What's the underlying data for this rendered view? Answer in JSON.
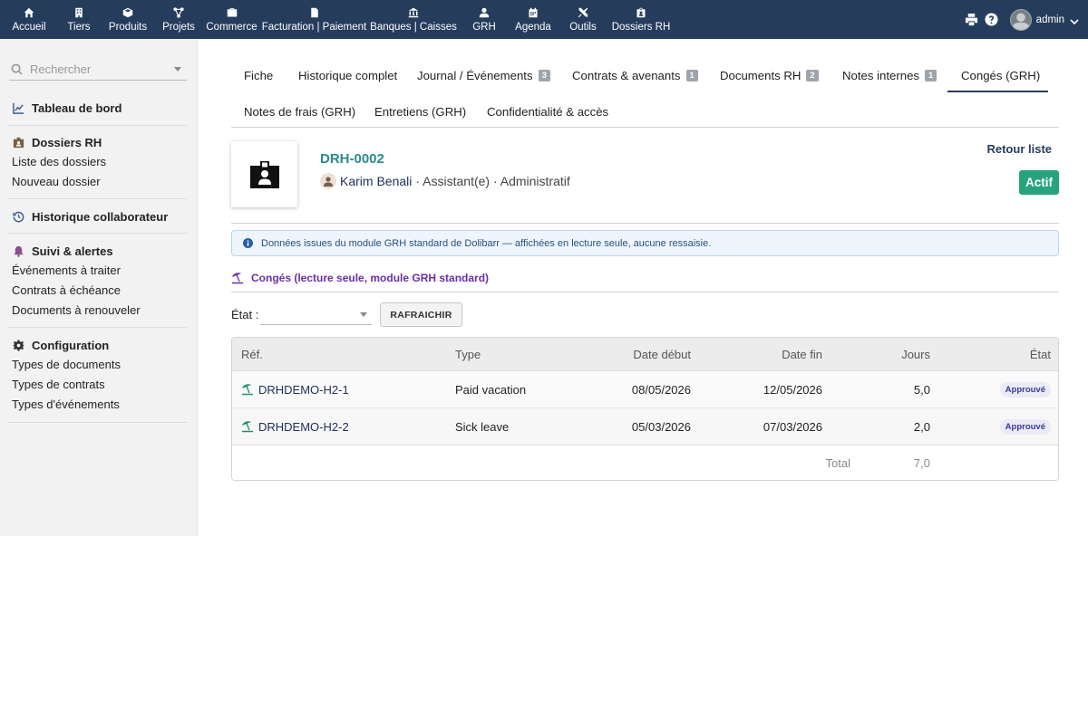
{
  "topnav": {
    "items": [
      {
        "label": "Accueil",
        "icon": "home-icon"
      },
      {
        "label": "Tiers",
        "icon": "building-icon"
      },
      {
        "label": "Produits",
        "icon": "cube-icon"
      },
      {
        "label": "Projets",
        "icon": "project-icon"
      },
      {
        "label": "Commerce",
        "icon": "briefcase-icon"
      },
      {
        "label": "Facturation | Paiement",
        "icon": "invoice-icon"
      },
      {
        "label": "Banques | Caisses",
        "icon": "bank-icon"
      },
      {
        "label": "GRH",
        "icon": "user-tie-icon"
      },
      {
        "label": "Agenda",
        "icon": "calendar-icon"
      },
      {
        "label": "Outils",
        "icon": "tools-icon"
      },
      {
        "label": "Dossiers RH",
        "icon": "id-badge-icon"
      }
    ],
    "user": "admin"
  },
  "sidebar": {
    "search_placeholder": "Rechercher",
    "dashboard": "Tableau de bord",
    "dossiers": {
      "title": "Dossiers RH",
      "items": [
        "Liste des dossiers",
        "Nouveau dossier"
      ]
    },
    "historique": "Historique collaborateur",
    "suivi": {
      "title": "Suivi & alertes",
      "items": [
        "Événements à traiter",
        "Contrats à échéance",
        "Documents à renouveler"
      ]
    },
    "config": {
      "title": "Configuration",
      "items": [
        "Types de documents",
        "Types de contrats",
        "Types d'événements"
      ]
    }
  },
  "tabs": {
    "fiche": "Fiche",
    "historique": "Historique complet",
    "journal": {
      "label": "Journal / Événements",
      "badge": "3"
    },
    "contrats": {
      "label": "Contrats & avenants",
      "badge": "1"
    },
    "documents": {
      "label": "Documents RH",
      "badge": "2"
    },
    "notes": {
      "label": "Notes internes",
      "badge": "1"
    },
    "conges": "Congés (GRH)",
    "frais": "Notes de frais (GRH)",
    "entretiens": "Entretiens (GRH)",
    "confidentialite": "Confidentialité & accès"
  },
  "header": {
    "ref": "DRH-0002",
    "employee_name": "Karim Benali",
    "employee_rest": "· Assistant(e) · Administratif",
    "back_link": "Retour liste",
    "status": "Actif",
    "status_color": "#27a37e"
  },
  "info_message": "Données issues du module GRH standard de Dolibarr — affichées en lecture seule, aucune ressaisie.",
  "section_title": "Congés (lecture seule, module GRH standard)",
  "filter": {
    "label": "État :",
    "value": "",
    "refresh_button": "RAFRAICHIR"
  },
  "table": {
    "headers": {
      "ref": "Réf.",
      "type": "Type",
      "date_debut": "Date début",
      "date_fin": "Date fin",
      "jours": "Jours",
      "etat": "État"
    },
    "rows": [
      {
        "ref": "DRHDEMO-H2-1",
        "type": "Paid vacation",
        "date_debut": "08/05/2026",
        "date_fin": "12/05/2026",
        "jours": "5,0",
        "etat": "Approuvé"
      },
      {
        "ref": "DRHDEMO-H2-2",
        "type": "Sick leave",
        "date_debut": "05/03/2026",
        "date_fin": "07/03/2026",
        "jours": "2,0",
        "etat": "Approuvé"
      }
    ],
    "total_label": "Total",
    "total_value": "7,0"
  }
}
